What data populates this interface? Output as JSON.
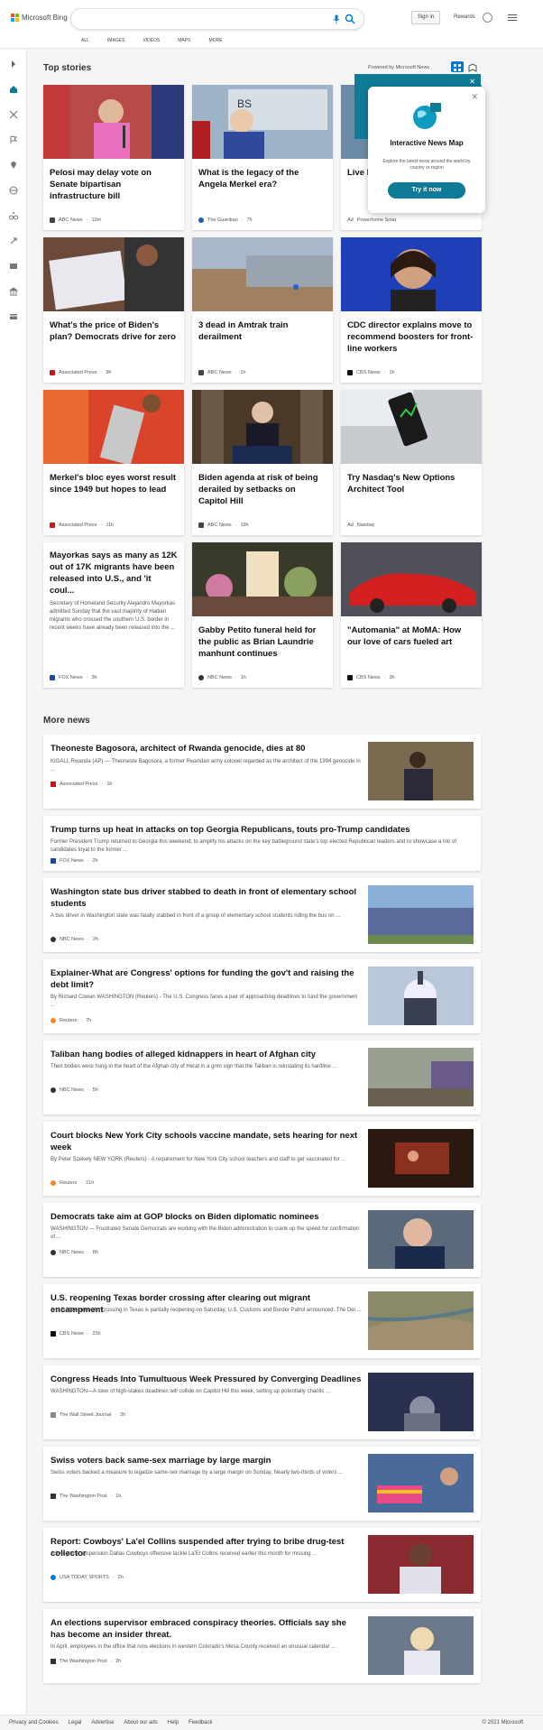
{
  "header": {
    "brand": "Microsoft Bing",
    "nav": [
      "ALL",
      "IMAGES",
      "VIDEOS",
      "MAPS",
      "MORE"
    ],
    "sign_in": "Sign in",
    "rewards": "Rewards"
  },
  "top_stories": {
    "title": "Top stories",
    "powered_by": "Powered by Microsoft News",
    "cards": [
      {
        "title": "Pelosi may delay vote on Senate bipartisan infrastructure bill",
        "source": "ABC News",
        "time": "12m",
        "desc": ""
      },
      {
        "title": "What is the legacy of the Angela Merkel era?",
        "source": "The Guardian",
        "time": "7h",
        "desc": ""
      },
      {
        "title": "Live l… Gene… Insta…",
        "source": "Powerhome Solar",
        "time": "",
        "ad": "Ad",
        "desc": ""
      },
      {
        "title": "What's the price of Biden's plan? Democrats drive for zero",
        "source": "Associated Press",
        "time": "9h",
        "desc": ""
      },
      {
        "title": "3 dead in Amtrak train derailment",
        "source": "ABC News",
        "time": "1h",
        "desc": ""
      },
      {
        "title": "CDC director explains move to recommend boosters for front-line workers",
        "source": "CBS News",
        "time": "1h",
        "desc": ""
      },
      {
        "title": "Merkel's bloc eyes worst result since 1949 but hopes to lead",
        "source": "Associated Press",
        "time": "11h",
        "desc": ""
      },
      {
        "title": "Biden agenda at risk of being derailed by setbacks on Capitol Hill",
        "source": "ABC News",
        "time": "19h",
        "desc": ""
      },
      {
        "title": "Try Nasdaq's New Options Architect Tool",
        "source": "Nasdaq",
        "time": "",
        "ad": "Ad",
        "desc": ""
      },
      {
        "title": "Mayorkas says as many as 12K out of 17K migrants have been released into U.S., and 'it coul...",
        "source": "FOX News",
        "time": "3h",
        "desc": "Secretary of Homeland Security Alejandro Mayorkas admitted Sunday that the vast majority of Haitian migrants who crossed the southern U.S. border in recent weeks have already been released into the ..."
      },
      {
        "title": "Gabby Petito funeral held for the public as Brian Laundrie manhunt continues",
        "source": "NBC News",
        "time": "1h",
        "desc": ""
      },
      {
        "title": "\"Automania\" at MoMA: How our love of cars fueled art",
        "source": "CBS News",
        "time": "3h",
        "desc": ""
      }
    ]
  },
  "popup": {
    "title": "Interactive News Map",
    "subtitle": "Explore the latest news around the world by country or region",
    "button": "Try it now",
    "behind": "ow"
  },
  "more_news": {
    "title": "More news",
    "items": [
      {
        "title": "Theoneste Bagosora, architect of Rwanda genocide, dies at 80",
        "body": "KIGALI, Rwanda (AP) — Theoneste Bagosora, a former Rwandan army colonel regarded as the architect of the 1994 genocide in ...",
        "source": "Associated Press",
        "time": "1h"
      },
      {
        "title": "Trump turns up heat in attacks on top Georgia Republicans, touts pro-Trump candidates",
        "body": "Former President Trump returned to Georgia this weekend, to amplify his attacks on the key battleground state's top elected Republican leaders and to showcase a trio of candidates loyal to the former ...",
        "source": "FOX News",
        "time": "2h"
      },
      {
        "title": "Washington state bus driver stabbed to death in front of elementary school students",
        "body": "A bus driver in Washington state was fatally stabbed in front of a group of elementary school students riding the bus on ...",
        "source": "NBC News",
        "time": "2h"
      },
      {
        "title": "Explainer-What are Congress' options for funding the gov't and raising the debt limit?",
        "body": "By Richard Cowan WASHINGTON (Reuters) - The U.S. Congress faces a pair of approaching deadlines to fund the government ...",
        "source": "Reuters",
        "time": "7h"
      },
      {
        "title": "Taliban hang bodies of alleged kidnappers in heart of Afghan city",
        "body": "Their bodies were hung in the heart of the Afghan city of Herat in a grim sign that the Taliban is reinstating its hardline ...",
        "source": "NBC News",
        "time": "5h"
      },
      {
        "title": "Court blocks New York City schools vaccine mandate, sets hearing for next week",
        "body": "By Peter Szekely NEW YORK (Reuters) - A requirement for New York City school teachers and staff to get vaccinated for ...",
        "source": "Reuters",
        "time": "21h"
      },
      {
        "title": "Democrats take aim at GOP blocks on Biden diplomatic nominees",
        "body": "WASHINGTON — Frustrated Senate Democrats are working with the Biden administration to crank up the speed for confirmation of ...",
        "source": "NBC News",
        "time": "8h"
      },
      {
        "title": "U.S. reopening Texas border crossing after clearing out migrant encampment",
        "body": "A U.S-Mexico border crossing in Texas is partially reopening on Saturday, U.S. Customs and Border Patrol announced. The Del ...",
        "source": "CBS News",
        "time": "23h"
      },
      {
        "title": "Congress Heads Into Tumultuous Week Pressured by Converging Deadlines",
        "body": "WASHINGTON—A slew of high-stakes deadlines will collide on Capitol Hill this week, setting up potentially chaotic ...",
        "source": "The Wall Street Journal",
        "time": "2h"
      },
      {
        "title": "Swiss voters back same-sex marriage by large margin",
        "body": "Swiss voters backed a measure to legalize same-sex marriage by a large margin on Sunday. Nearly two-thirds of voters ...",
        "source": "The Washington Post",
        "time": "1h"
      },
      {
        "title": "Report: Cowboys' La'el Collins suspended after trying to bribe drug-test collector",
        "body": "A five-game suspension Dallas Cowboys offensive tackle La'El Collins received earlier this month for missing ...",
        "source": "USA TODAY SPORTS",
        "time": "2h"
      },
      {
        "title": "An elections supervisor embraced conspiracy theories. Officials say she has become an insider threat.",
        "body": "In April, employees in the office that runs elections in western Colorado's Mesa County received an unusual calendar ...",
        "source": "The Washington Post",
        "time": "2h"
      }
    ]
  },
  "footer": {
    "links": [
      "Privacy and Cookies",
      "Legal",
      "Advertise",
      "About our ads",
      "Help",
      "Feedback"
    ],
    "copyright": "© 2021 Microsoft"
  },
  "colors": {
    "accent": "#0f7b97",
    "brand_blue": "#0078d4"
  }
}
